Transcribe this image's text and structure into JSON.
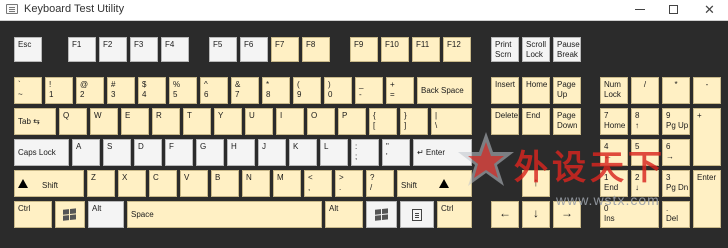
{
  "window": {
    "title": "Keyboard Test Utility",
    "min_icon": "minimize-icon",
    "max_icon": "maximize-icon",
    "close_glyph": "✕"
  },
  "colors": {
    "key_normal": "#fff0c4",
    "key_tested": "#f4f4f4",
    "background": "#2b2b2b",
    "watermark": "#d9261f"
  },
  "keys": [
    {
      "id": "esc",
      "lines": [
        "Esc"
      ],
      "tested": true
    },
    {
      "id": "f1",
      "lines": [
        "F1"
      ],
      "tested": true
    },
    {
      "id": "f2",
      "lines": [
        "F2"
      ],
      "tested": true
    },
    {
      "id": "f3",
      "lines": [
        "F3"
      ],
      "tested": true
    },
    {
      "id": "f4",
      "lines": [
        "F4"
      ],
      "tested": true
    },
    {
      "id": "f5",
      "lines": [
        "F5"
      ],
      "tested": true
    },
    {
      "id": "f6",
      "lines": [
        "F6"
      ],
      "tested": true
    },
    {
      "id": "f7",
      "lines": [
        "F7"
      ],
      "tested": false
    },
    {
      "id": "f8",
      "lines": [
        "F8"
      ],
      "tested": false
    },
    {
      "id": "f9",
      "lines": [
        "F9"
      ],
      "tested": false
    },
    {
      "id": "f10",
      "lines": [
        "F10"
      ],
      "tested": false
    },
    {
      "id": "f11",
      "lines": [
        "F11"
      ],
      "tested": false
    },
    {
      "id": "f12",
      "lines": [
        "F12"
      ],
      "tested": false
    },
    {
      "id": "printscrn",
      "lines": [
        "Print",
        "Scrn"
      ],
      "tested": true
    },
    {
      "id": "scrolllock",
      "lines": [
        "Scroll",
        "Lock"
      ],
      "tested": true
    },
    {
      "id": "pausebreak",
      "lines": [
        "Pause",
        "Break"
      ],
      "tested": true
    },
    {
      "id": "backtick",
      "lines": [
        "`",
        "~"
      ],
      "tested": false
    },
    {
      "id": "d1",
      "lines": [
        "!",
        "1"
      ],
      "tested": false
    },
    {
      "id": "d2",
      "lines": [
        "@",
        "2"
      ],
      "tested": false
    },
    {
      "id": "d3",
      "lines": [
        "#",
        "3"
      ],
      "tested": false
    },
    {
      "id": "d4",
      "lines": [
        "$",
        "4"
      ],
      "tested": false
    },
    {
      "id": "d5",
      "lines": [
        "%",
        "5"
      ],
      "tested": false
    },
    {
      "id": "d6",
      "lines": [
        "^",
        "6"
      ],
      "tested": false
    },
    {
      "id": "d7",
      "lines": [
        "&",
        "7"
      ],
      "tested": false
    },
    {
      "id": "d8",
      "lines": [
        "*",
        "8"
      ],
      "tested": false
    },
    {
      "id": "d9",
      "lines": [
        "(",
        "9"
      ],
      "tested": false
    },
    {
      "id": "d0",
      "lines": [
        ")",
        "0"
      ],
      "tested": false
    },
    {
      "id": "minus",
      "lines": [
        "_",
        "-"
      ],
      "tested": false
    },
    {
      "id": "equals",
      "lines": [
        "+",
        "="
      ],
      "tested": false
    },
    {
      "id": "backspace",
      "lines": [
        "Back Space"
      ],
      "tested": false
    },
    {
      "id": "insert",
      "lines": [
        "Insert"
      ],
      "tested": false
    },
    {
      "id": "home",
      "lines": [
        "Home"
      ],
      "tested": false
    },
    {
      "id": "pageup",
      "lines": [
        "Page",
        "Up"
      ],
      "tested": false
    },
    {
      "id": "numlock",
      "lines": [
        "Num",
        "Lock"
      ],
      "tested": false
    },
    {
      "id": "numdiv",
      "lines": [
        "/"
      ],
      "tested": false
    },
    {
      "id": "nummul",
      "lines": [
        "*"
      ],
      "tested": false
    },
    {
      "id": "numsub",
      "lines": [
        "-"
      ],
      "tested": false
    },
    {
      "id": "tab",
      "lines": [
        "Tab  ⇆"
      ],
      "tested": false
    },
    {
      "id": "q",
      "lines": [
        "Q"
      ],
      "tested": false
    },
    {
      "id": "w",
      "lines": [
        "W"
      ],
      "tested": false
    },
    {
      "id": "e",
      "lines": [
        "E"
      ],
      "tested": false
    },
    {
      "id": "r",
      "lines": [
        "R"
      ],
      "tested": false
    },
    {
      "id": "t",
      "lines": [
        "T"
      ],
      "tested": false
    },
    {
      "id": "y",
      "lines": [
        "Y"
      ],
      "tested": false
    },
    {
      "id": "u",
      "lines": [
        "U"
      ],
      "tested": false
    },
    {
      "id": "i",
      "lines": [
        "I"
      ],
      "tested": false
    },
    {
      "id": "o",
      "lines": [
        "O"
      ],
      "tested": false
    },
    {
      "id": "p",
      "lines": [
        "P"
      ],
      "tested": false
    },
    {
      "id": "lbracket",
      "lines": [
        "{",
        "["
      ],
      "tested": false
    },
    {
      "id": "rbracket",
      "lines": [
        "}",
        "]"
      ],
      "tested": false
    },
    {
      "id": "backslash",
      "lines": [
        "|",
        "\\"
      ],
      "tested": false
    },
    {
      "id": "delete",
      "lines": [
        "Delete"
      ],
      "tested": false
    },
    {
      "id": "end",
      "lines": [
        "End"
      ],
      "tested": false
    },
    {
      "id": "pagedown",
      "lines": [
        "Page",
        "Down"
      ],
      "tested": false
    },
    {
      "id": "num7",
      "lines": [
        "7",
        "Home"
      ],
      "tested": false
    },
    {
      "id": "num8",
      "lines": [
        "8",
        "↑"
      ],
      "tested": false
    },
    {
      "id": "num9",
      "lines": [
        "9",
        "Pg Up"
      ],
      "tested": false
    },
    {
      "id": "numadd",
      "lines": [
        "+"
      ],
      "tested": false
    },
    {
      "id": "capslock",
      "lines": [
        "Caps Lock"
      ],
      "tested": true
    },
    {
      "id": "a",
      "lines": [
        "A"
      ],
      "tested": true
    },
    {
      "id": "s",
      "lines": [
        "S"
      ],
      "tested": true
    },
    {
      "id": "d",
      "lines": [
        "D"
      ],
      "tested": true
    },
    {
      "id": "f",
      "lines": [
        "F"
      ],
      "tested": true
    },
    {
      "id": "g",
      "lines": [
        "G"
      ],
      "tested": true
    },
    {
      "id": "h",
      "lines": [
        "H"
      ],
      "tested": true
    },
    {
      "id": "j",
      "lines": [
        "J"
      ],
      "tested": true
    },
    {
      "id": "k",
      "lines": [
        "K"
      ],
      "tested": true
    },
    {
      "id": "l",
      "lines": [
        "L"
      ],
      "tested": true
    },
    {
      "id": "semicolon",
      "lines": [
        ":",
        ";"
      ],
      "tested": true
    },
    {
      "id": "quote",
      "lines": [
        "\"",
        "'"
      ],
      "tested": true
    },
    {
      "id": "enter",
      "lines": [
        "↵  Enter"
      ],
      "tested": true
    },
    {
      "id": "num4",
      "lines": [
        "4",
        "←"
      ],
      "tested": false
    },
    {
      "id": "num5",
      "lines": [
        "5"
      ],
      "tested": false
    },
    {
      "id": "num6",
      "lines": [
        "6",
        "→"
      ],
      "tested": false
    },
    {
      "id": "lshift",
      "lines": [
        "Shift"
      ],
      "tested": false
    },
    {
      "id": "z",
      "lines": [
        "Z"
      ],
      "tested": false
    },
    {
      "id": "x",
      "lines": [
        "X"
      ],
      "tested": false
    },
    {
      "id": "c",
      "lines": [
        "C"
      ],
      "tested": false
    },
    {
      "id": "v",
      "lines": [
        "V"
      ],
      "tested": false
    },
    {
      "id": "b",
      "lines": [
        "B"
      ],
      "tested": false
    },
    {
      "id": "n",
      "lines": [
        "N"
      ],
      "tested": false
    },
    {
      "id": "m",
      "lines": [
        "M"
      ],
      "tested": false
    },
    {
      "id": "comma",
      "lines": [
        "<",
        ","
      ],
      "tested": false
    },
    {
      "id": "period",
      "lines": [
        ">",
        "."
      ],
      "tested": false
    },
    {
      "id": "slash",
      "lines": [
        "?",
        "/"
      ],
      "tested": false
    },
    {
      "id": "rshift",
      "lines": [
        "Shift"
      ],
      "tested": false
    },
    {
      "id": "up",
      "lines": [
        "↑"
      ],
      "tested": false
    },
    {
      "id": "num1",
      "lines": [
        "1",
        "End"
      ],
      "tested": false
    },
    {
      "id": "num2",
      "lines": [
        "2",
        "↓"
      ],
      "tested": false
    },
    {
      "id": "num3",
      "lines": [
        "3",
        "Pg Dn"
      ],
      "tested": false
    },
    {
      "id": "numenter",
      "lines": [
        "Enter"
      ],
      "tested": false
    },
    {
      "id": "lctrl",
      "lines": [
        "Ctrl"
      ],
      "tested": false
    },
    {
      "id": "lwin",
      "lines": [],
      "tested": false
    },
    {
      "id": "lalt",
      "lines": [
        "Alt"
      ],
      "tested": true
    },
    {
      "id": "space",
      "lines": [
        "Space"
      ],
      "tested": false
    },
    {
      "id": "ralt",
      "lines": [
        "Alt"
      ],
      "tested": false
    },
    {
      "id": "rwin",
      "lines": [],
      "tested": true
    },
    {
      "id": "menu",
      "lines": [],
      "tested": true
    },
    {
      "id": "rctrl",
      "lines": [
        "Ctrl"
      ],
      "tested": false
    },
    {
      "id": "left",
      "lines": [
        "←"
      ],
      "tested": false
    },
    {
      "id": "down",
      "lines": [
        "↓"
      ],
      "tested": false
    },
    {
      "id": "right",
      "lines": [
        "→"
      ],
      "tested": false
    },
    {
      "id": "num0",
      "lines": [
        "0",
        "Ins"
      ],
      "tested": false
    },
    {
      "id": "numdel",
      "lines": [
        ".",
        "Del"
      ],
      "tested": false
    }
  ],
  "watermark": {
    "text": "外设天下",
    "url": "www.wstx.com",
    "icon": "star-logo-icon"
  }
}
